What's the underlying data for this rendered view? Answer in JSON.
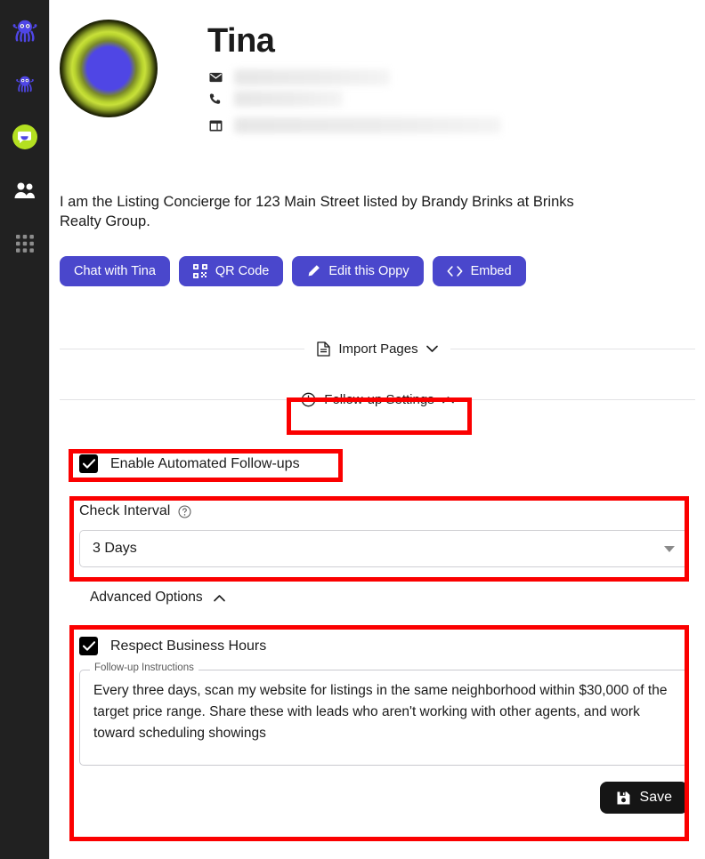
{
  "sidebar": {
    "items": [
      {
        "name": "octopus-logo",
        "label": "Octopus Logo"
      },
      {
        "name": "octopus-nav",
        "label": "Octopus"
      },
      {
        "name": "chat-active",
        "label": "Chat"
      },
      {
        "name": "contacts",
        "label": "Contacts"
      },
      {
        "name": "apps-grid",
        "label": "Apps"
      }
    ]
  },
  "profile": {
    "name": "Tina",
    "avatar_colors": {
      "outer": "#000000",
      "mid": "#b9d42e",
      "inner": "#4f46e5"
    },
    "contact": {
      "email_icon": "envelope-icon",
      "phone_icon": "phone-icon",
      "card_icon": "window-icon",
      "email_value": "",
      "phone_value": "",
      "address_value": ""
    },
    "description": "I am the Listing Concierge for 123 Main Street listed by Brandy Brinks at Brinks Realty Group."
  },
  "actions": {
    "accent_color": "#4a47cc",
    "buttons": [
      {
        "label": "Chat with Tina",
        "icon": "none",
        "name": "chat-with-tina-button"
      },
      {
        "label": "QR Code",
        "icon": "qr-code-icon",
        "name": "qr-code-button"
      },
      {
        "label": "Edit this Oppy",
        "icon": "pencil-icon",
        "name": "edit-oppy-button"
      },
      {
        "label": "Embed",
        "icon": "code-brackets-icon",
        "name": "embed-button"
      }
    ]
  },
  "sections": {
    "import_pages": {
      "label": "Import Pages",
      "icon": "document-icon",
      "chevron": "⌄",
      "expanded": false
    },
    "followup_settings": {
      "label": "Follow-up Settings",
      "icon": "clock-icon",
      "chevron": "⌃",
      "expanded": true
    }
  },
  "followup": {
    "enable_label": "Enable Automated Follow-ups",
    "enable_checked": true,
    "check_interval": {
      "label": "Check Interval",
      "help_icon": "help-circle-icon",
      "value": "3 Days"
    },
    "advanced_options": {
      "label": "Advanced Options",
      "chevron": "⌃",
      "expanded": true
    },
    "respect_business_hours": {
      "label": "Respect Business Hours",
      "checked": true
    },
    "instructions": {
      "legend": "Follow-up Instructions",
      "value": "Every three days, scan my website for listings in the same neighborhood within $30,000 of the target price range. Share these with leads who aren't working with other agents, and work toward scheduling showings"
    },
    "save": {
      "label": "Save",
      "icon": "save-disk-icon"
    }
  },
  "annotations": {
    "color": "#fb0000"
  }
}
